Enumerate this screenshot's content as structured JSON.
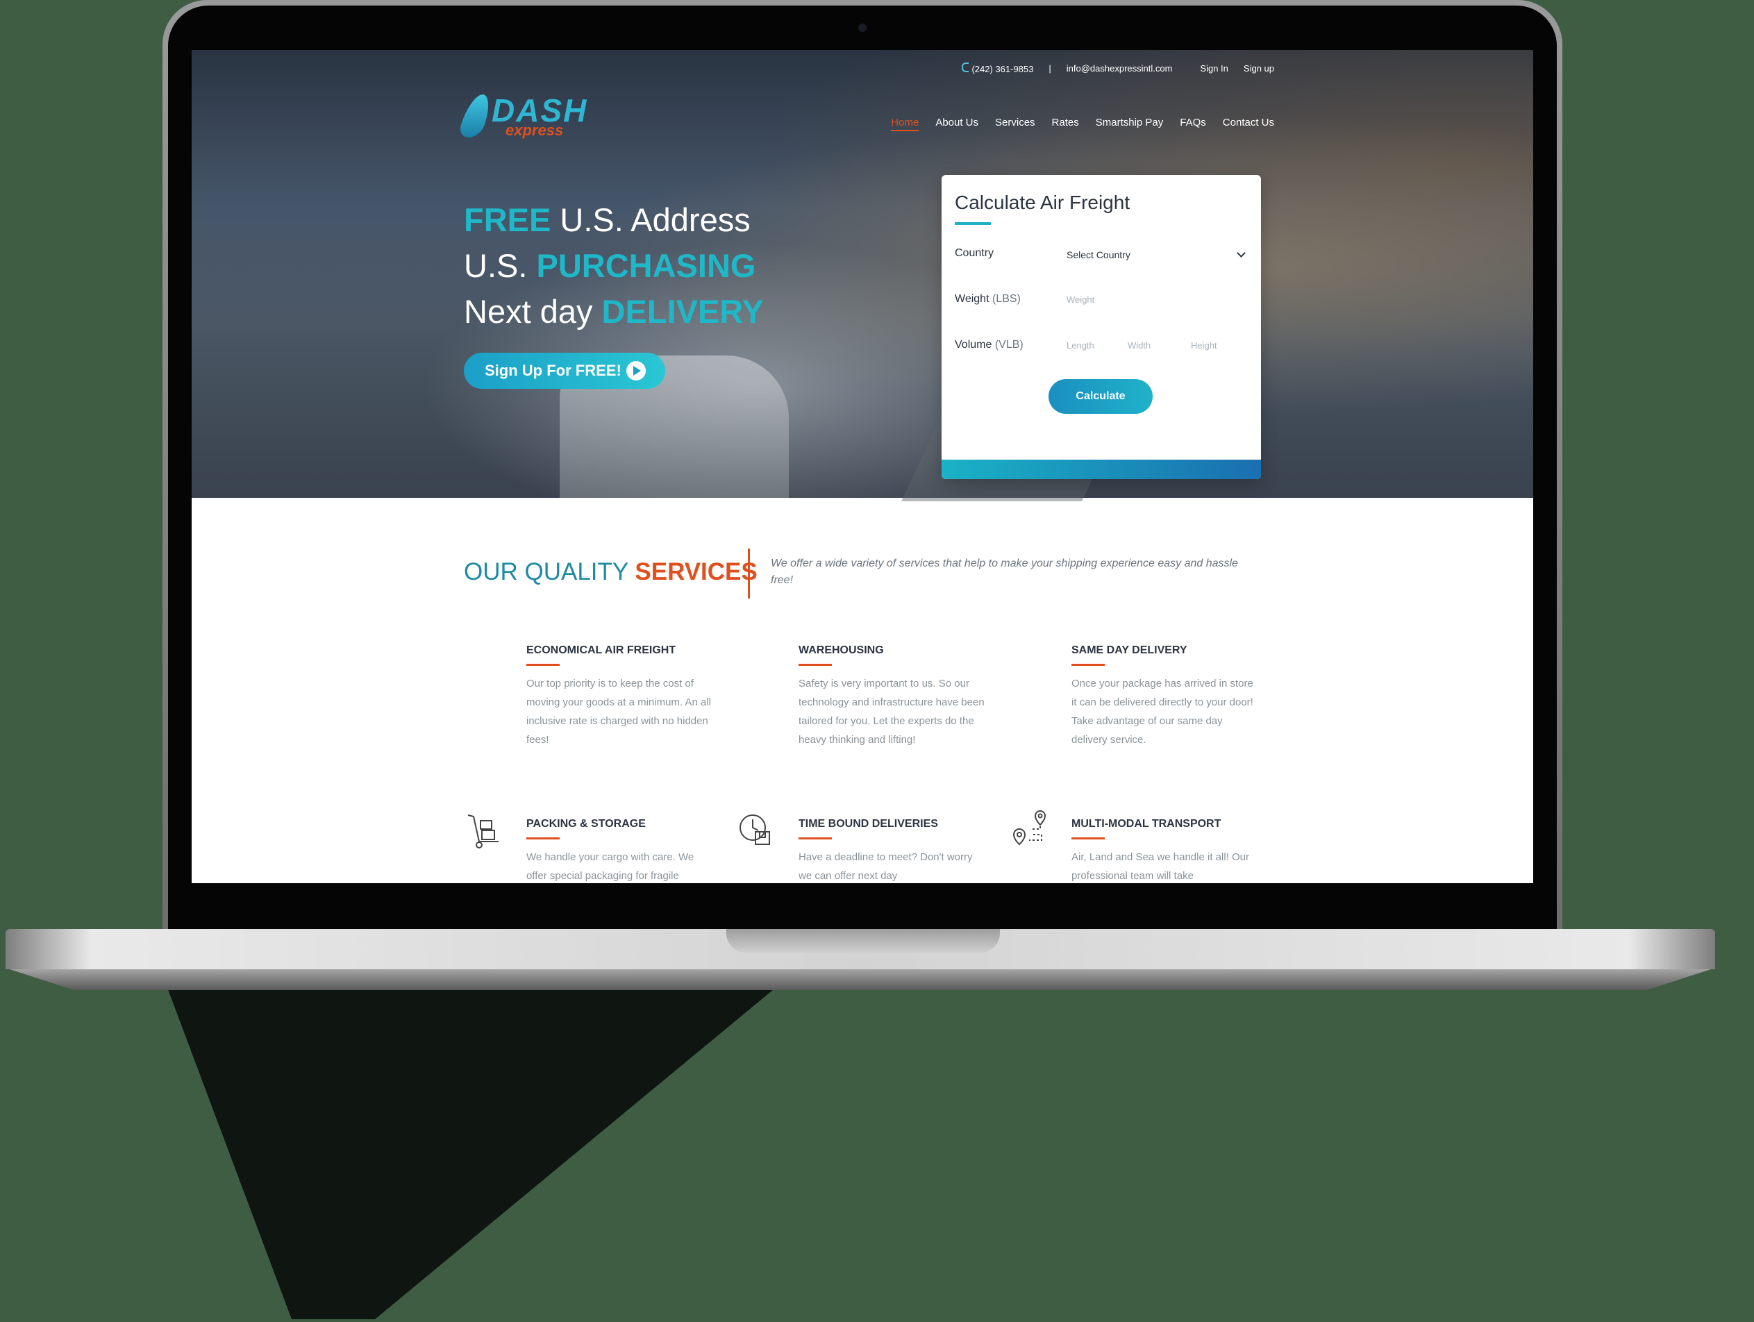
{
  "topbar": {
    "phone": "(242) 361-9853",
    "separator": "|",
    "email": "info@dashexpressintl.com",
    "sign_in": "Sign In",
    "sign_up": "Sign up"
  },
  "logo": {
    "name": "DASH",
    "sub": "express"
  },
  "nav": {
    "items": [
      {
        "label": "Home",
        "active": true
      },
      {
        "label": "About Us"
      },
      {
        "label": "Services"
      },
      {
        "label": "Rates"
      },
      {
        "label": "Smartship Pay"
      },
      {
        "label": "FAQs"
      },
      {
        "label": "Contact Us"
      }
    ]
  },
  "hero": {
    "line1_accent": "FREE",
    "line1_rest": "U.S. Address",
    "line2_pre": "U.S.",
    "line2_accent": "PURCHASING",
    "line3_pre": "Next day",
    "line3_accent": "DELIVERY",
    "cta_label": "Sign Up For FREE!"
  },
  "calculator": {
    "title": "Calculate Air Freight",
    "country_label": "Country",
    "country_value": "Select Country",
    "weight_label": "Weight",
    "weight_unit": "(LBS)",
    "weight_placeholder": "Weight",
    "volume_label": "Volume",
    "volume_unit": "(VLB)",
    "length_placeholder": "Length",
    "width_placeholder": "Width",
    "height_placeholder": "Height",
    "button_label": "Calculate"
  },
  "services": {
    "heading_pre": "OUR QUALITY",
    "heading_accent": "SERVICES",
    "tagline": "We offer a wide variety of services that help to make your shipping experience easy and hassle free!",
    "items": [
      {
        "title": "ECONOMICAL AIR FREIGHT",
        "desc": "Our top priority is to keep the cost of moving your goods at a minimum. An all inclusive rate is charged with no hidden fees!"
      },
      {
        "title": "WAREHOUSING",
        "desc": "Safety is very important to us. So our technology and infrastructure have been tailored for you. Let the experts do the heavy thinking and lifting!"
      },
      {
        "title": "SAME DAY DELIVERY",
        "desc": "Once your package has arrived in store it can be delivered directly to your door! Take advantage of our same day delivery service."
      },
      {
        "title": "PACKING & STORAGE",
        "desc": "We handle your cargo with care. We offer special packaging for fragile",
        "icon": "hand-truck-icon"
      },
      {
        "title": "TIME BOUND DELIVERIES",
        "desc": "Have a deadline to meet? Don't worry we can offer next day",
        "icon": "clock-package-icon"
      },
      {
        "title": "MULTI-MODAL TRANSPORT",
        "desc": "Air, Land and Sea we handle it all! Our professional team will take",
        "icon": "route-pin-icon"
      }
    ]
  },
  "colors": {
    "accent_orange": "#e0501f",
    "accent_teal": "#1fb8c9"
  }
}
